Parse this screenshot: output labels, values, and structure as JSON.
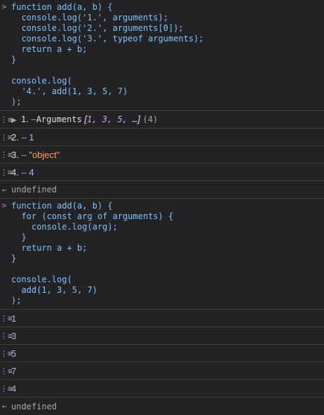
{
  "console": {
    "icons": {
      "input": "prompt-chevron-icon",
      "log": "log-entry-icon",
      "result": "return-arrow-icon",
      "expand": "disclosure-triangle-icon"
    },
    "glyphs": {
      "input": ">",
      "log": "⋮≡",
      "result": "←",
      "expand": "▶"
    },
    "block1": {
      "code": "function add(a, b) {\n  console.log('1.', arguments);\n  console.log('2.', arguments[0]);\n  console.log('3.', typeof arguments);\n  return a + b;\n}\n\nconsole.log(\n  '4.', add(1, 3, 5, 7)\n);",
      "logs": [
        {
          "label": "1.",
          "dash": "–",
          "name": "Arguments",
          "open": "[",
          "items": "1, 3, 5, …",
          "close": "]",
          "count": "(4)"
        },
        {
          "label": "2.",
          "dash": "–",
          "value": "1"
        },
        {
          "label": "3.",
          "dash": "–",
          "value": "\"object\""
        },
        {
          "label": "4.",
          "dash": "–",
          "value": "4"
        }
      ],
      "result": "undefined"
    },
    "block2": {
      "code": "function add(a, b) {\n  for (const arg of arguments) {\n    console.log(arg);\n  }\n  return a + b;\n}\n\nconsole.log(\n  add(1, 3, 5, 7)\n);",
      "logs": [
        "1",
        "3",
        "5",
        "7",
        "4"
      ],
      "result": "undefined"
    }
  },
  "colors": {
    "background": "#232325",
    "code": "#7cc3ff",
    "number": "#d69cff",
    "string": "#ff9f56",
    "muted": "#a6a6aa",
    "divider": "#3b3b3d"
  }
}
